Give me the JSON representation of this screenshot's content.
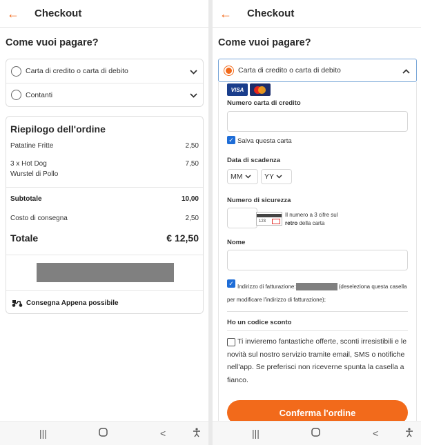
{
  "header": {
    "title": "Checkout",
    "back_icon": "arrow-left-icon"
  },
  "left": {
    "section_title": "Come vuoi pagare?",
    "payment_options": [
      {
        "label": "Carta di credito o carta di debito"
      },
      {
        "label": "Contanti"
      }
    ],
    "summary": {
      "title": "Riepilogo dell'ordine",
      "items": [
        {
          "name": "Patatine Fritte",
          "price": "2,50"
        },
        {
          "name": "3 x Hot Dog",
          "sub": "Wurstel di Pollo",
          "price": "7,50"
        }
      ],
      "subtotal_label": "Subtotale",
      "subtotal_value": "10,00",
      "delivery_cost_label": "Costo di consegna",
      "delivery_cost_value": "2,50",
      "total_label": "Totale",
      "total_value": "€ 12,50",
      "delivery_text": "Consegna Appena possibile"
    }
  },
  "right": {
    "section_title": "Come vuoi pagare?",
    "selected_option": "Carta di credito o carta di debito",
    "card_logos": [
      "VISA",
      "MasterCard"
    ],
    "card_number_label": "Numero carta di credito",
    "save_card_label": "Salva questa carta",
    "save_card_checked": true,
    "expiry_label": "Data di scadenza",
    "month_value": "MM",
    "year_value": "YY",
    "cvv_label": "Numero di sicurezza",
    "cvv_image_text": "123",
    "cvv_hint_1": "Il numero a 3 cifre sul",
    "cvv_hint_bold": "retro",
    "cvv_hint_2": "della carta",
    "name_label": "Nome",
    "billing_prefix": "Indirizzo di fatturazione:",
    "billing_suffix": "(deseleziona questa casella per modificare l'indirizzo di fatturazione);",
    "billing_checked": true,
    "discount_label": "Ho un codice sconto",
    "promo_text": "Ti invieremo fantastiche offerte, sconti irresistibili e le novità sul nostro servizio tramite email, SMS o notifiche nell'app. Se preferisci non riceverne spunta la casella a fianco.",
    "promo_checked": false,
    "confirm_label": "Conferma l'ordine"
  },
  "navbar": {
    "recents": "|||",
    "home": "○",
    "back": "<",
    "accessibility": "accessibility-icon"
  },
  "colors": {
    "accent": "#f26a1b",
    "checkbox": "#1e6dd7",
    "redaction": "#808080"
  }
}
